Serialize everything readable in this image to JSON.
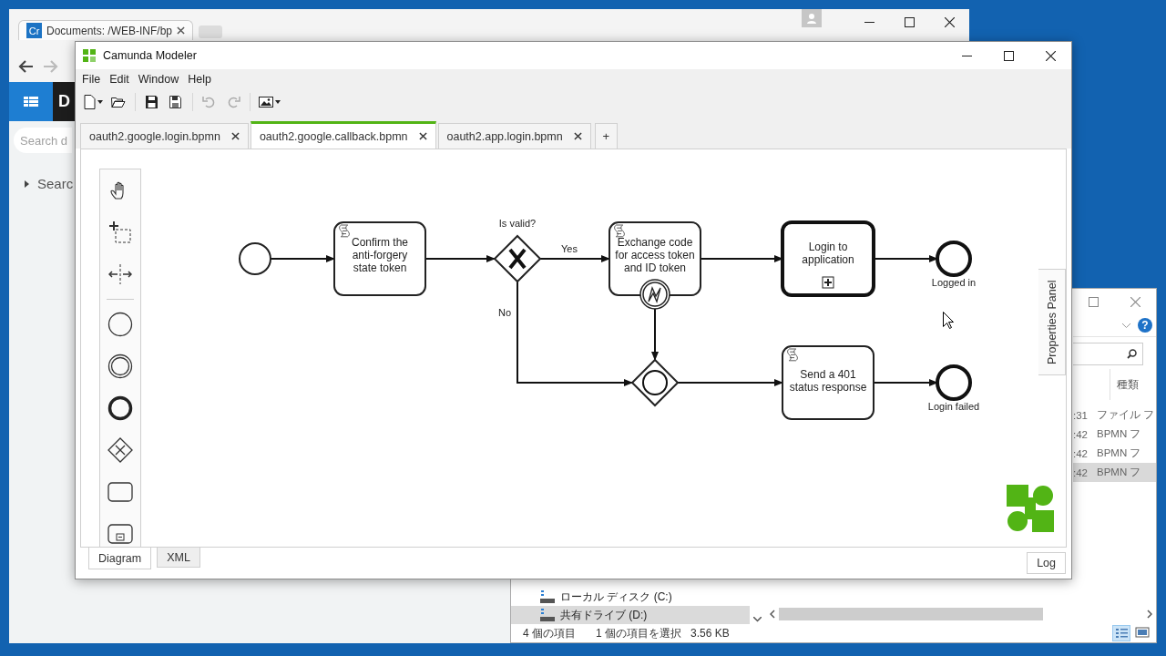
{
  "browser": {
    "tab": {
      "badge": "Cr",
      "title": "Documents: /WEB-INF/bp"
    },
    "logo_letter": "D",
    "search": {
      "placeholder": "Search d"
    },
    "tree_item": "Searc"
  },
  "explorer": {
    "help_button": "?",
    "column_header": "種類",
    "rows": [
      {
        "time": ":31",
        "type": "ファイル フ",
        "selected": false
      },
      {
        "time": ":42",
        "type": "BPMN フ",
        "selected": false
      },
      {
        "time": ":42",
        "type": "BPMN フ",
        "selected": false
      },
      {
        "time": ":42",
        "type": "BPMN フ",
        "selected": true
      }
    ],
    "nav_items": [
      {
        "label": "ローカル ディスク (C:)",
        "selected": false
      },
      {
        "label": "共有ドライブ (D:)",
        "selected": true
      }
    ],
    "status": {
      "item_count": "4 個の項目",
      "selection": "1 個の項目を選択",
      "size": "3.56 KB"
    }
  },
  "modeler": {
    "title": "Camunda Modeler",
    "menu": [
      "File",
      "Edit",
      "Window",
      "Help"
    ],
    "tabs": [
      {
        "label": "oauth2.google.login.bpmn",
        "selected": false
      },
      {
        "label": "oauth2.google.callback.bpmn",
        "selected": true
      },
      {
        "label": "oauth2.app.login.bpmn",
        "selected": false
      }
    ],
    "add_tab": "+",
    "diagram": {
      "nodes": [
        {
          "kind": "start-event"
        },
        {
          "kind": "script-task",
          "lines": [
            "Confirm the",
            "anti-forgery",
            "state token"
          ]
        },
        {
          "kind": "exclusive-gateway",
          "label": "Is valid?"
        },
        {
          "kind": "script-task",
          "lines": [
            "Exchange code",
            "for access token",
            "and ID token"
          ]
        },
        {
          "kind": "error-boundary-event"
        },
        {
          "kind": "collapsed-subprocess",
          "lines": [
            "Login to",
            "application"
          ]
        },
        {
          "kind": "end-event",
          "label": "Logged in"
        },
        {
          "kind": "event-gateway"
        },
        {
          "kind": "script-task",
          "lines": [
            "Send a 401",
            "status response"
          ]
        },
        {
          "kind": "end-event",
          "label": "Login failed"
        }
      ],
      "flow_labels": [
        "Yes",
        "No"
      ]
    },
    "properties_panel": "Properties Panel",
    "view_tabs": [
      {
        "label": "Diagram",
        "selected": true
      },
      {
        "label": "XML",
        "selected": false
      }
    ],
    "log_button": "Log"
  }
}
